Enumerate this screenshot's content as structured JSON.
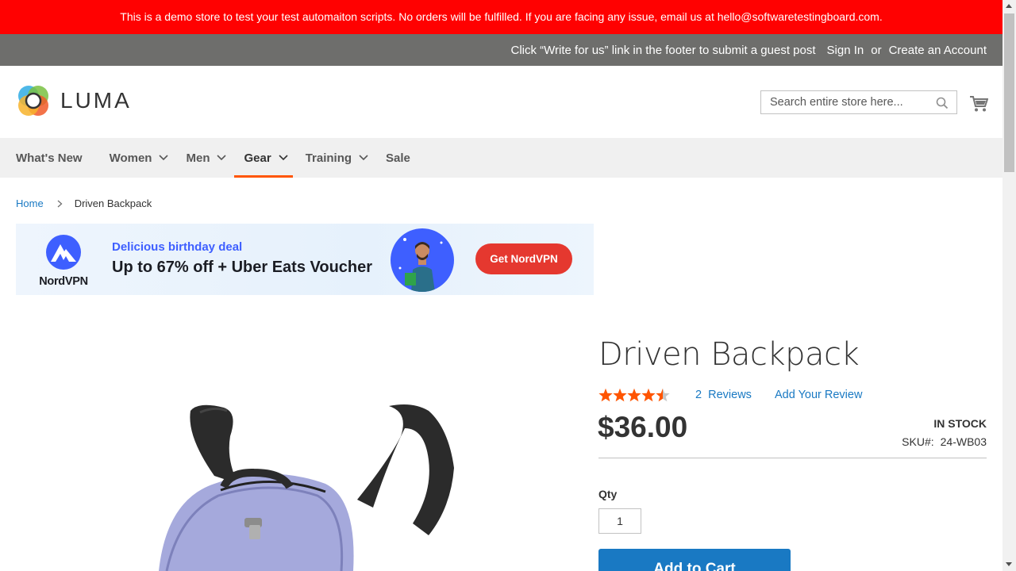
{
  "demo_banner": {
    "text": "This is a demo store to test your test automaiton scripts. No orders will be fulfilled. If you are facing any issue, email us at hello@softwaretestingboard.com."
  },
  "top_links": {
    "guest_post": "Click “Write for us” link in the footer to submit a guest post",
    "sign_in": "Sign In",
    "or": "or",
    "create_account": "Create an Account"
  },
  "header": {
    "logo_text": "LUMA",
    "search_placeholder": "Search entire store here...",
    "search_value": ""
  },
  "nav": {
    "items": [
      {
        "label": "What's New",
        "dropdown": false
      },
      {
        "label": "Women",
        "dropdown": true
      },
      {
        "label": "Men",
        "dropdown": true
      },
      {
        "label": "Gear",
        "dropdown": true,
        "active": true
      },
      {
        "label": "Training",
        "dropdown": true
      },
      {
        "label": "Sale",
        "dropdown": false
      }
    ]
  },
  "breadcrumb": {
    "home": "Home",
    "current": "Driven Backpack"
  },
  "ad": {
    "brand": "NordVPN",
    "headline": "Delicious birthday deal",
    "offer": "Up to 67% off + Uber Eats Voucher",
    "cta": "Get NordVPN"
  },
  "product": {
    "title": "Driven Backpack",
    "rating_stars": 4.5,
    "rating_max": 5,
    "reviews_count": "2",
    "reviews_label": "Reviews",
    "add_review": "Add Your Review",
    "price": "$36.00",
    "stock": "In stock",
    "sku_label": "SKU#:",
    "sku_value": "24-WB03",
    "qty_label": "Qty",
    "qty_value": "1",
    "add_to_cart": "Add to Cart"
  },
  "colors": {
    "demo_banner_bg": "#ff0101",
    "topbar_bg": "#6e6e6c",
    "nav_bg": "#f0f0f0",
    "nav_active_underline": "#ff5501",
    "link": "#1979c3",
    "star": "#ff5501",
    "primary_button": "#1979c3",
    "ad_cta": "#e5382f",
    "ad_accent": "#3e5fff"
  },
  "icons": [
    "luma-logo-icon",
    "search-icon",
    "cart-icon",
    "chevron-down-icon",
    "chevron-right-icon",
    "nordvpn-logo-icon",
    "star-icon"
  ]
}
